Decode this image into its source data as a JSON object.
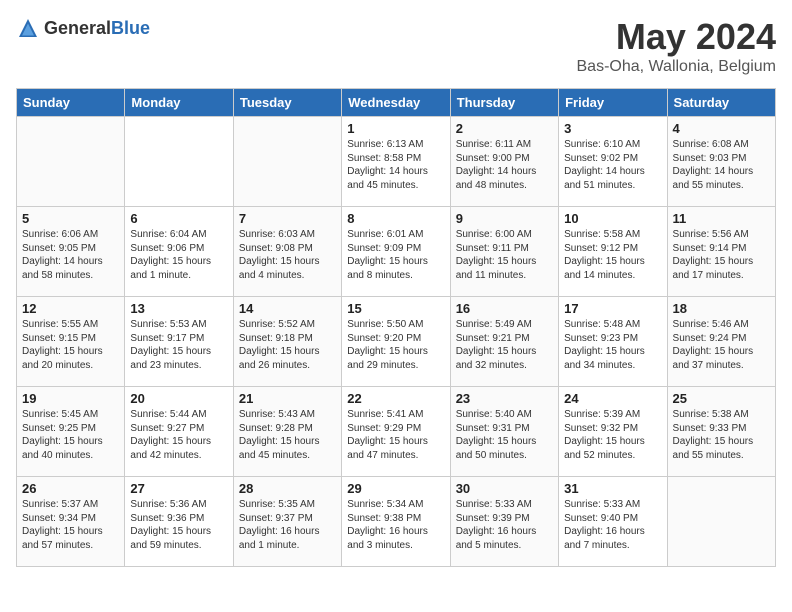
{
  "header": {
    "logo_general": "General",
    "logo_blue": "Blue",
    "month": "May 2024",
    "location": "Bas-Oha, Wallonia, Belgium"
  },
  "weekdays": [
    "Sunday",
    "Monday",
    "Tuesday",
    "Wednesday",
    "Thursday",
    "Friday",
    "Saturday"
  ],
  "weeks": [
    [
      {
        "day": "",
        "info": ""
      },
      {
        "day": "",
        "info": ""
      },
      {
        "day": "",
        "info": ""
      },
      {
        "day": "1",
        "info": "Sunrise: 6:13 AM\nSunset: 8:58 PM\nDaylight: 14 hours\nand 45 minutes."
      },
      {
        "day": "2",
        "info": "Sunrise: 6:11 AM\nSunset: 9:00 PM\nDaylight: 14 hours\nand 48 minutes."
      },
      {
        "day": "3",
        "info": "Sunrise: 6:10 AM\nSunset: 9:02 PM\nDaylight: 14 hours\nand 51 minutes."
      },
      {
        "day": "4",
        "info": "Sunrise: 6:08 AM\nSunset: 9:03 PM\nDaylight: 14 hours\nand 55 minutes."
      }
    ],
    [
      {
        "day": "5",
        "info": "Sunrise: 6:06 AM\nSunset: 9:05 PM\nDaylight: 14 hours\nand 58 minutes."
      },
      {
        "day": "6",
        "info": "Sunrise: 6:04 AM\nSunset: 9:06 PM\nDaylight: 15 hours\nand 1 minute."
      },
      {
        "day": "7",
        "info": "Sunrise: 6:03 AM\nSunset: 9:08 PM\nDaylight: 15 hours\nand 4 minutes."
      },
      {
        "day": "8",
        "info": "Sunrise: 6:01 AM\nSunset: 9:09 PM\nDaylight: 15 hours\nand 8 minutes."
      },
      {
        "day": "9",
        "info": "Sunrise: 6:00 AM\nSunset: 9:11 PM\nDaylight: 15 hours\nand 11 minutes."
      },
      {
        "day": "10",
        "info": "Sunrise: 5:58 AM\nSunset: 9:12 PM\nDaylight: 15 hours\nand 14 minutes."
      },
      {
        "day": "11",
        "info": "Sunrise: 5:56 AM\nSunset: 9:14 PM\nDaylight: 15 hours\nand 17 minutes."
      }
    ],
    [
      {
        "day": "12",
        "info": "Sunrise: 5:55 AM\nSunset: 9:15 PM\nDaylight: 15 hours\nand 20 minutes."
      },
      {
        "day": "13",
        "info": "Sunrise: 5:53 AM\nSunset: 9:17 PM\nDaylight: 15 hours\nand 23 minutes."
      },
      {
        "day": "14",
        "info": "Sunrise: 5:52 AM\nSunset: 9:18 PM\nDaylight: 15 hours\nand 26 minutes."
      },
      {
        "day": "15",
        "info": "Sunrise: 5:50 AM\nSunset: 9:20 PM\nDaylight: 15 hours\nand 29 minutes."
      },
      {
        "day": "16",
        "info": "Sunrise: 5:49 AM\nSunset: 9:21 PM\nDaylight: 15 hours\nand 32 minutes."
      },
      {
        "day": "17",
        "info": "Sunrise: 5:48 AM\nSunset: 9:23 PM\nDaylight: 15 hours\nand 34 minutes."
      },
      {
        "day": "18",
        "info": "Sunrise: 5:46 AM\nSunset: 9:24 PM\nDaylight: 15 hours\nand 37 minutes."
      }
    ],
    [
      {
        "day": "19",
        "info": "Sunrise: 5:45 AM\nSunset: 9:25 PM\nDaylight: 15 hours\nand 40 minutes."
      },
      {
        "day": "20",
        "info": "Sunrise: 5:44 AM\nSunset: 9:27 PM\nDaylight: 15 hours\nand 42 minutes."
      },
      {
        "day": "21",
        "info": "Sunrise: 5:43 AM\nSunset: 9:28 PM\nDaylight: 15 hours\nand 45 minutes."
      },
      {
        "day": "22",
        "info": "Sunrise: 5:41 AM\nSunset: 9:29 PM\nDaylight: 15 hours\nand 47 minutes."
      },
      {
        "day": "23",
        "info": "Sunrise: 5:40 AM\nSunset: 9:31 PM\nDaylight: 15 hours\nand 50 minutes."
      },
      {
        "day": "24",
        "info": "Sunrise: 5:39 AM\nSunset: 9:32 PM\nDaylight: 15 hours\nand 52 minutes."
      },
      {
        "day": "25",
        "info": "Sunrise: 5:38 AM\nSunset: 9:33 PM\nDaylight: 15 hours\nand 55 minutes."
      }
    ],
    [
      {
        "day": "26",
        "info": "Sunrise: 5:37 AM\nSunset: 9:34 PM\nDaylight: 15 hours\nand 57 minutes."
      },
      {
        "day": "27",
        "info": "Sunrise: 5:36 AM\nSunset: 9:36 PM\nDaylight: 15 hours\nand 59 minutes."
      },
      {
        "day": "28",
        "info": "Sunrise: 5:35 AM\nSunset: 9:37 PM\nDaylight: 16 hours\nand 1 minute."
      },
      {
        "day": "29",
        "info": "Sunrise: 5:34 AM\nSunset: 9:38 PM\nDaylight: 16 hours\nand 3 minutes."
      },
      {
        "day": "30",
        "info": "Sunrise: 5:33 AM\nSunset: 9:39 PM\nDaylight: 16 hours\nand 5 minutes."
      },
      {
        "day": "31",
        "info": "Sunrise: 5:33 AM\nSunset: 9:40 PM\nDaylight: 16 hours\nand 7 minutes."
      },
      {
        "day": "",
        "info": ""
      }
    ]
  ]
}
